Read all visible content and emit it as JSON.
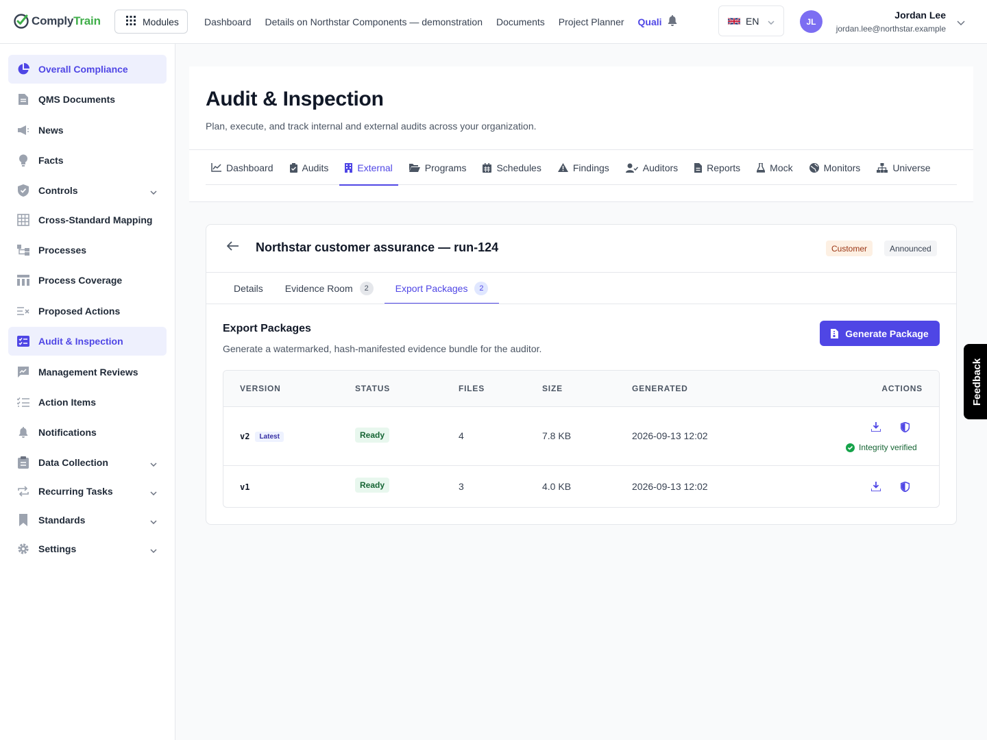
{
  "brand": {
    "name_part1": "Comply",
    "name_part2": "Train"
  },
  "topbar": {
    "modules_label": "Modules",
    "nav": [
      "Dashboard",
      "Details on Northstar Components — demonstration",
      "Documents",
      "Project Planner"
    ],
    "active_nav": "Quali",
    "language": "EN",
    "user_initials": "JL",
    "user_name": "Jordan Lee",
    "user_email": "jordan.lee@northstar.example"
  },
  "sidebar": {
    "items": [
      {
        "label": "Overall Compliance",
        "icon": "pie-chart-icon",
        "active": true
      },
      {
        "label": "QMS Documents",
        "icon": "document-icon"
      },
      {
        "label": "News",
        "icon": "megaphone-icon"
      },
      {
        "label": "Facts",
        "icon": "lightbulb-icon"
      },
      {
        "label": "Controls",
        "icon": "shield-check-icon",
        "expandable": true
      },
      {
        "label": "Cross-Standard Mapping",
        "icon": "table-icon"
      },
      {
        "label": "Processes",
        "icon": "flow-icon"
      },
      {
        "label": "Process Coverage",
        "icon": "coverage-icon"
      },
      {
        "label": "Proposed Actions",
        "icon": "list-x-icon"
      },
      {
        "label": "Audit & Inspection",
        "icon": "audit-icon",
        "active": true
      },
      {
        "label": "Management Reviews",
        "icon": "chart-chat-icon"
      },
      {
        "label": "Action Items",
        "icon": "checklist-icon"
      },
      {
        "label": "Notifications",
        "icon": "bell-icon"
      },
      {
        "label": "Data Collection",
        "icon": "clipboard-icon",
        "expandable": true
      },
      {
        "label": "Recurring Tasks",
        "icon": "repeat-icon",
        "expandable": true
      },
      {
        "label": "Standards",
        "icon": "bookmark-icon",
        "expandable": true
      },
      {
        "label": "Settings",
        "icon": "gear-icon",
        "expandable": true
      }
    ]
  },
  "page": {
    "title": "Audit & Inspection",
    "subtitle": "Plan, execute, and track internal and external audits across your organization.",
    "tabs": [
      {
        "label": "Dashboard",
        "icon": "line-chart-icon"
      },
      {
        "label": "Audits",
        "icon": "clipboard-check-icon"
      },
      {
        "label": "External",
        "icon": "building-icon",
        "active": true
      },
      {
        "label": "Programs",
        "icon": "folder-open-icon"
      },
      {
        "label": "Schedules",
        "icon": "calendar-icon"
      },
      {
        "label": "Findings",
        "icon": "warning-icon"
      },
      {
        "label": "Auditors",
        "icon": "user-check-icon"
      },
      {
        "label": "Reports",
        "icon": "file-icon"
      },
      {
        "label": "Mock",
        "icon": "flask-icon"
      },
      {
        "label": "Monitors",
        "icon": "globe-icon"
      },
      {
        "label": "Universe",
        "icon": "sitemap-icon"
      }
    ]
  },
  "audit": {
    "title": "Northstar customer assurance — run-124",
    "badges": [
      "Customer",
      "Announced"
    ],
    "subtabs": [
      {
        "label": "Details"
      },
      {
        "label": "Evidence Room",
        "count": "2"
      },
      {
        "label": "Export Packages",
        "count": "2",
        "active": true
      }
    ],
    "export": {
      "title": "Export Packages",
      "description": "Generate a watermarked, hash-manifested evidence bundle for the auditor.",
      "button_label": "Generate Package",
      "columns": [
        "VERSION",
        "STATUS",
        "FILES",
        "SIZE",
        "GENERATED",
        "ACTIONS"
      ],
      "rows": [
        {
          "version": "v2",
          "latest_label": "Latest",
          "status": "Ready",
          "files": "4",
          "size": "7.8 KB",
          "generated": "2026-09-13 12:02",
          "integrity": "Integrity verified"
        },
        {
          "version": "v1",
          "status": "Ready",
          "files": "3",
          "size": "4.0 KB",
          "generated": "2026-09-13 12:02"
        }
      ]
    }
  },
  "feedback_label": "Feedback",
  "colors": {
    "accent": "#4f46e5",
    "success": "#166534",
    "brand_green": "#3fae49"
  }
}
